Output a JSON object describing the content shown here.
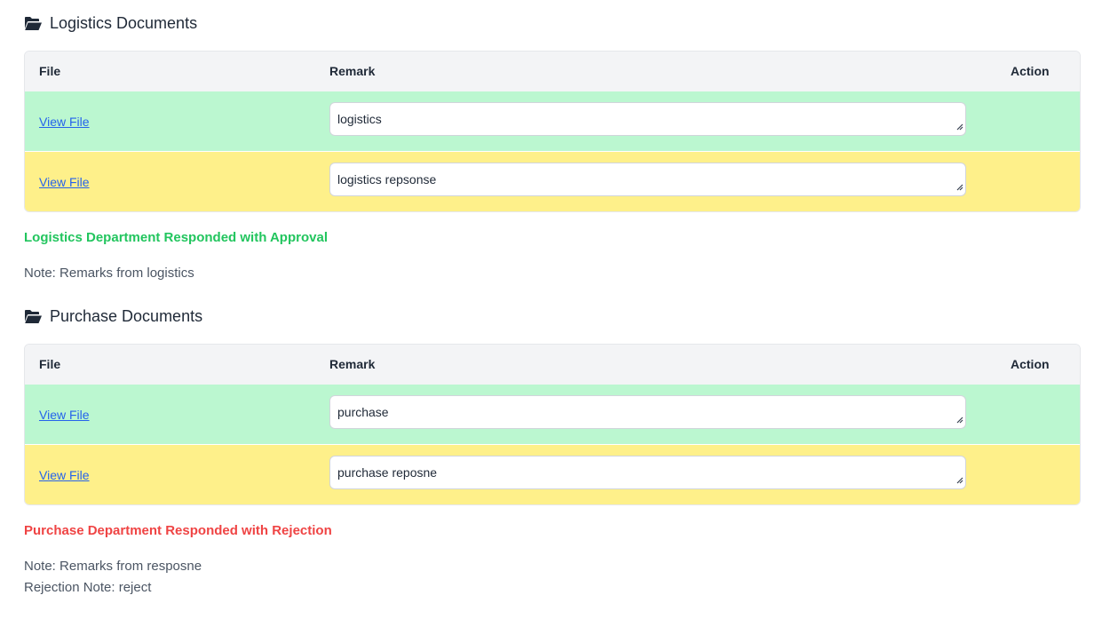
{
  "colors": {
    "approved_row": "#bbf7d0",
    "response_row": "#fef08a",
    "approval_text": "#22c55e",
    "rejection_text": "#ef4444",
    "link": "#2563eb"
  },
  "icons": {
    "section": "folder-open-icon",
    "resize": "resize-grip-icon"
  },
  "logistics": {
    "title": "Logistics Documents",
    "headers": {
      "file": "File",
      "remark": "Remark",
      "action": "Action"
    },
    "rows": [
      {
        "file_link": "View File",
        "remark": "logistics"
      },
      {
        "file_link": "View File",
        "remark": "logistics repsonse"
      }
    ],
    "status": "Logistics Department Responded with Approval",
    "note": "Note: Remarks from logistics"
  },
  "purchase": {
    "title": "Purchase Documents",
    "headers": {
      "file": "File",
      "remark": "Remark",
      "action": "Action"
    },
    "rows": [
      {
        "file_link": "View File",
        "remark": "purchase"
      },
      {
        "file_link": "View File",
        "remark": "purchase reposne"
      }
    ],
    "status": "Purchase Department Responded with Rejection",
    "note": "Note: Remarks from resposne",
    "rejection_note": "Rejection Note: reject"
  }
}
